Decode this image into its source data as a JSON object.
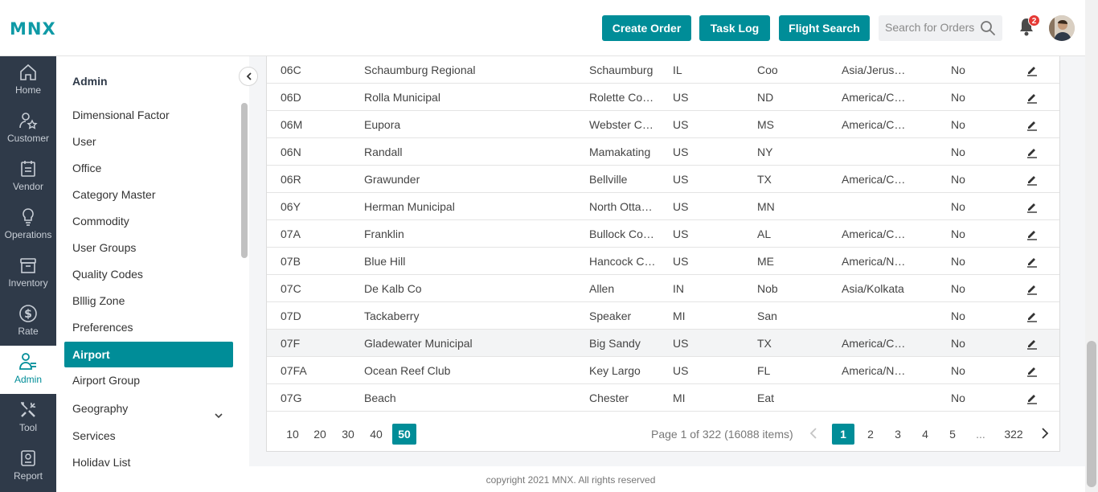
{
  "header": {
    "logo": "MNX",
    "buttons": {
      "create_order": "Create Order",
      "task_log": "Task Log",
      "flight_search": "Flight Search"
    },
    "search_placeholder": "Search for Orders",
    "notification_count": "2"
  },
  "rail": [
    "Home",
    "Customer",
    "Vendor",
    "Operations",
    "Inventory",
    "Rate",
    "Admin",
    "Tool",
    "Report"
  ],
  "submenu": {
    "title": "Admin",
    "items": [
      "Dimensional Factor",
      "User",
      "Office",
      "Category Master",
      "Commodity",
      "User Groups",
      "Quality Codes",
      "Blllig Zone",
      "Preferences",
      "Airport",
      "Airport Group",
      "Geography",
      "Services",
      "Holiday List"
    ]
  },
  "table": {
    "rows": [
      [
        "06C",
        "Schaumburg Regional",
        "Schaumburg",
        "IL",
        "Coo",
        "Asia/Jerus…",
        "No"
      ],
      [
        "06D",
        "Rolla Municipal",
        "Rolette Co…",
        "US",
        "ND",
        "America/C…",
        "No"
      ],
      [
        "06M",
        "Eupora",
        "Webster C…",
        "US",
        "MS",
        "America/C…",
        "No"
      ],
      [
        "06N",
        "Randall",
        "Mamakating",
        "US",
        "NY",
        "",
        "No"
      ],
      [
        "06R",
        "Grawunder",
        "Bellville",
        "US",
        "TX",
        "America/C…",
        "No"
      ],
      [
        "06Y",
        "Herman Municipal",
        "North Otta…",
        "US",
        "MN",
        "",
        "No"
      ],
      [
        "07A",
        "Franklin",
        "Bullock Co…",
        "US",
        "AL",
        "America/C…",
        "No"
      ],
      [
        "07B",
        "Blue Hill",
        "Hancock C…",
        "US",
        "ME",
        "America/N…",
        "No"
      ],
      [
        "07C",
        "De Kalb Co",
        "Allen",
        "IN",
        "Nob",
        "Asia/Kolkata",
        "No"
      ],
      [
        "07D",
        "Tackaberry",
        "Speaker",
        "MI",
        "San",
        "",
        "No"
      ],
      [
        "07F",
        "Gladewater Municipal",
        "Big Sandy",
        "US",
        "TX",
        "America/C…",
        "No"
      ],
      [
        "07FA",
        "Ocean Reef Club",
        "Key Largo",
        "US",
        "FL",
        "America/N…",
        "No"
      ],
      [
        "07G",
        "Beach",
        "Chester",
        "MI",
        "Eat",
        "",
        "No"
      ]
    ]
  },
  "pager": {
    "page_sizes": [
      "10",
      "20",
      "30",
      "40",
      "50"
    ],
    "info": "Page 1 of 322 (16088 items)",
    "pages": [
      "1",
      "2",
      "3",
      "4",
      "5"
    ],
    "ellipsis": "...",
    "last_page": "322"
  },
  "footer": "copyright 2021 MNX. All rights reserved",
  "colors": {
    "accent": "#008d98",
    "rail": "#2f3a49",
    "logo": "#0f9aa6"
  }
}
